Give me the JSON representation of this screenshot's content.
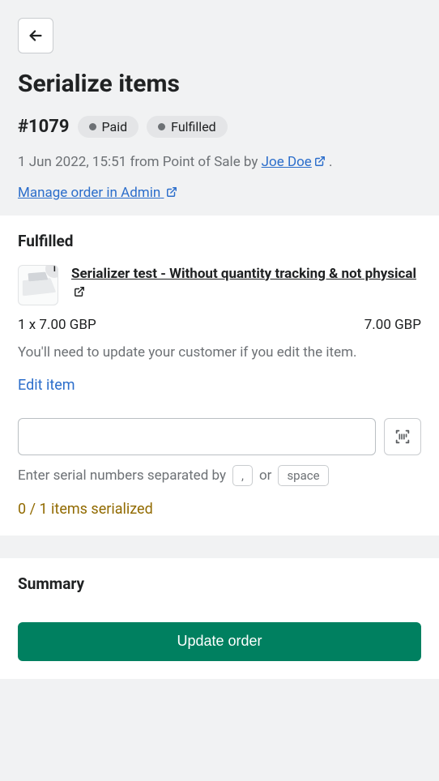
{
  "header": {
    "title": "Serialize items",
    "order_number": "#1079",
    "badges": {
      "paid": "Paid",
      "fulfilled": "Fulfilled"
    },
    "meta_prefix": "1 Jun 2022, 15:51 from Point of Sale by ",
    "author": "Joe Doe",
    "meta_suffix": " .",
    "admin_link": "Manage order in Admin"
  },
  "fulfilled": {
    "title": "Fulfilled",
    "qty_badge": "1",
    "product_title": "Serializer test - Without quantity tracking & not physical",
    "price_left": "1 x 7.00 GBP",
    "price_right": "7.00 GBP",
    "hint": "You'll need to update your customer if you edit the item.",
    "edit_link": "Edit item",
    "help_prefix": "Enter serial numbers separated by",
    "chip_comma": ",",
    "help_or": "or",
    "chip_space": "space",
    "status": "0 / 1 items serialized"
  },
  "summary": {
    "title": "Summary",
    "button": "Update order"
  }
}
